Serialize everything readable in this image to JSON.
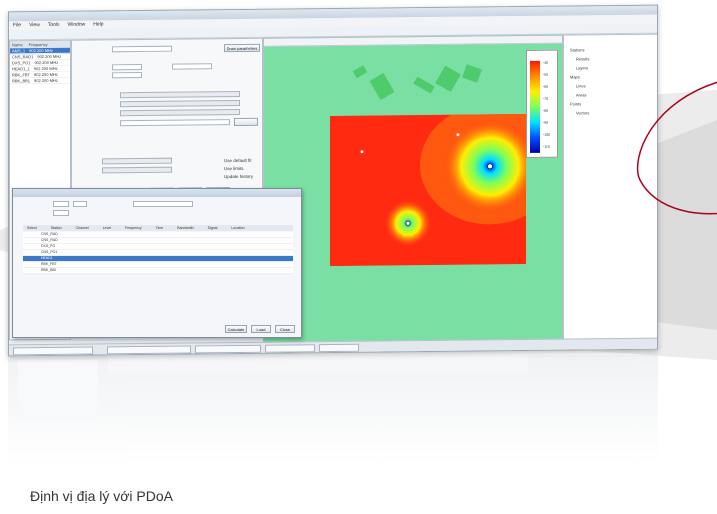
{
  "window": {
    "menu": [
      "File",
      "View",
      "Tools",
      "Window",
      "Help"
    ]
  },
  "left_list": {
    "headers": [
      "Name",
      "Frequency"
    ],
    "rows": [
      {
        "name": "AMS_1",
        "freq": "902.200 MHz",
        "selected": true
      },
      {
        "name": "CNS_RAD1",
        "freq": "902.200 MHz",
        "selected": false
      },
      {
        "name": "DXS_PO1",
        "freq": "902.200 MHz",
        "selected": false
      },
      {
        "name": "HEAD1_1",
        "freq": "902.200 MHz",
        "selected": false
      },
      {
        "name": "RBK_FBT",
        "freq": "902.200 MHz",
        "selected": false
      },
      {
        "name": "RBK_BB1",
        "freq": "902.200 MHz",
        "selected": false
      }
    ]
  },
  "properties": {
    "button_right": "Draw parameters",
    "ok": "OK",
    "cancel": "Cancel",
    "apply": "Apply",
    "check1": "Use default fit",
    "check2": "Use limits",
    "check3": "Update history"
  },
  "dialog": {
    "headers": [
      "Select",
      "Station",
      "Channel",
      "Level",
      "Frequency",
      "Time",
      "Bandwidth",
      "Signal",
      "Location"
    ],
    "rows": [
      {
        "cells": [
          "",
          "CNS_RAD"
        ],
        "selected": false
      },
      {
        "cells": [
          "",
          "CNS_RAD"
        ],
        "selected": false
      },
      {
        "cells": [
          "",
          "DXS_PO"
        ],
        "selected": false
      },
      {
        "cells": [
          "",
          "CNS_PO1"
        ],
        "selected": false
      },
      {
        "cells": [
          "",
          "HEAD1"
        ],
        "selected": true
      },
      {
        "cells": [
          "",
          "RBK_FBT"
        ],
        "selected": false
      },
      {
        "cells": [
          "",
          "RBK_BBI"
        ],
        "selected": false
      }
    ],
    "buttons": [
      "Calculate",
      "Load",
      "Close"
    ]
  },
  "legend": {
    "ticks": [
      "-40",
      "-50",
      "-60",
      "-70",
      "-80",
      "-90",
      "-100",
      "-110"
    ]
  },
  "tree": {
    "items": [
      "Stations",
      "Results",
      "Layers",
      "Maps",
      "Lines",
      "Areas",
      "Points",
      "Vectors"
    ]
  },
  "caption": "Định vị địa lý với PDoA",
  "colors": {
    "heat_high": "#ff2a10",
    "map_bg": "#79dfa2",
    "selection": "#3a78c9",
    "accent_arc": "#b00020"
  }
}
